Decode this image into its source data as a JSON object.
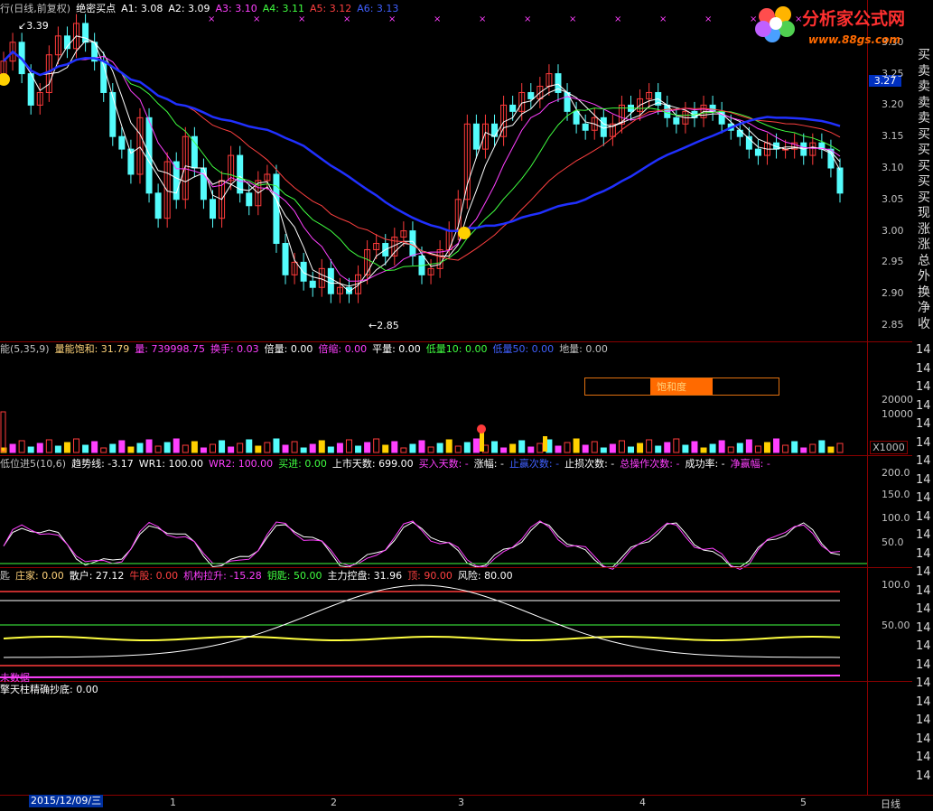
{
  "header": {
    "prefix": "行(日线,前复权)",
    "indicator": "绝密买点",
    "items": [
      {
        "label": "A1: 3.08",
        "color": "#ffffff"
      },
      {
        "label": "A2: 3.09",
        "color": "#ffffff"
      },
      {
        "label": "A3: 3.10",
        "color": "#ff40ff"
      },
      {
        "label": "A4: 3.11",
        "color": "#40ff40"
      },
      {
        "label": "A5: 3.12",
        "color": "#ff4040"
      },
      {
        "label": "A6: 3.13",
        "color": "#4060ff"
      }
    ]
  },
  "price_panel": {
    "high_mark": "3.39",
    "low_mark": "2.85",
    "current_price": "3.27",
    "axis": [
      "3.30",
      "3.25",
      "3.20",
      "3.15",
      "3.10",
      "3.05",
      "3.00",
      "2.95",
      "2.90",
      "2.85"
    ]
  },
  "volume_panel": {
    "header": [
      {
        "label": "能(5,35,9)",
        "color": "#c0c0c0"
      },
      {
        "label": "量能饱和: 31.79",
        "color": "#ffd37a"
      },
      {
        "label": "量: 739998.75",
        "color": "#ff40ff"
      },
      {
        "label": "换手: 0.03",
        "color": "#ff40ff"
      },
      {
        "label": "倍量: 0.00",
        "color": "#ffffff"
      },
      {
        "label": "倍缩: 0.00",
        "color": "#ff40ff"
      },
      {
        "label": "平量: 0.00",
        "color": "#ffffff"
      },
      {
        "label": "低量10: 0.00",
        "color": "#40ff40"
      },
      {
        "label": "低量50: 0.00",
        "color": "#4060ff"
      },
      {
        "label": "地量: 0.00",
        "color": "#c0c0c0"
      }
    ],
    "saturation_label": "饱和度",
    "axis": [
      "20000",
      "10000"
    ],
    "unit": "X1000"
  },
  "wr_panel": {
    "header": [
      {
        "label": "低位进5(10,6)",
        "color": "#c0c0c0"
      },
      {
        "label": "趋势线: -3.17",
        "color": "#ffffff"
      },
      {
        "label": "WR1: 100.00",
        "color": "#ffffff"
      },
      {
        "label": "WR2: 100.00",
        "color": "#ff40ff"
      },
      {
        "label": "买进: 0.00",
        "color": "#40ff40"
      },
      {
        "label": "上市天数: 699.00",
        "color": "#ffffff"
      },
      {
        "label": "买入天数: -",
        "color": "#ff40ff"
      },
      {
        "label": "涨幅: -",
        "color": "#ffffff"
      },
      {
        "label": "止赢次数: -",
        "color": "#4060ff"
      },
      {
        "label": "止损次数: -",
        "color": "#ffffff"
      },
      {
        "label": "总操作次数: -",
        "color": "#ff40ff"
      },
      {
        "label": "成功率: -",
        "color": "#ffffff"
      },
      {
        "label": "净赢幅: -",
        "color": "#ff40ff"
      }
    ],
    "axis": [
      "200.0",
      "150.0",
      "100.0",
      "50.0"
    ]
  },
  "chip_panel": {
    "header": [
      {
        "label": "匙",
        "color": "#c0c0c0"
      },
      {
        "label": "庄家: 0.00",
        "color": "#ffd37a"
      },
      {
        "label": "散户: 27.12",
        "color": "#ffffff"
      },
      {
        "label": "牛股: 0.00",
        "color": "#ff4040"
      },
      {
        "label": "机构拉升: -15.28",
        "color": "#ff40ff"
      },
      {
        "label": "钥匙: 50.00",
        "color": "#40ff40"
      },
      {
        "label": "主力控盘: 31.96",
        "color": "#ffffff"
      },
      {
        "label": "顶: 90.00",
        "color": "#ff4040"
      },
      {
        "label": "风险: 80.00",
        "color": "#ffffff"
      }
    ],
    "no_data": "未数据",
    "axis": [
      "100.0",
      "50.00"
    ]
  },
  "bottom_panel": {
    "header": "擎天柱精确抄底: 0.00"
  },
  "time_axis": {
    "date": "2015/12/09/三",
    "months": [
      "1",
      "2",
      "3",
      "4",
      "5"
    ],
    "period": "日线"
  },
  "right_labels": [
    "买",
    "卖",
    "卖",
    "卖",
    "卖",
    "买",
    "买",
    "买",
    "买",
    "买",
    "现",
    "涨",
    "涨",
    "总",
    "外",
    "换",
    "净",
    "收"
  ],
  "right_index": [
    "14",
    "14",
    "14",
    "14",
    "14",
    "14",
    "14",
    "14",
    "14",
    "14",
    "14",
    "14",
    "14",
    "14",
    "14",
    "14",
    "14",
    "14",
    "14",
    "14",
    "14",
    "14",
    "14",
    "14"
  ],
  "logo": {
    "text": "分析家公式网",
    "url": "www.88gs.com"
  },
  "chart_data": {
    "type": "candlestick",
    "title": "",
    "ylim": [
      2.85,
      3.39
    ],
    "close": [
      3.27,
      3.3,
      3.25,
      3.2,
      3.22,
      3.28,
      3.31,
      3.29,
      3.33,
      3.3,
      3.27,
      3.22,
      3.15,
      3.13,
      3.09,
      3.18,
      3.06,
      3.02,
      3.11,
      3.05,
      3.15,
      3.1,
      3.05,
      3.02,
      3.08,
      3.12,
      3.06,
      3.04,
      3.08,
      3.09,
      2.98,
      2.93,
      2.95,
      2.92,
      2.91,
      2.94,
      2.9,
      2.91,
      2.9,
      2.93,
      2.97,
      2.98,
      2.96,
      2.99,
      3.0,
      2.96,
      2.93,
      2.94,
      2.97,
      3.0,
      3.05,
      3.17,
      3.13,
      3.17,
      3.15,
      3.2,
      3.19,
      3.22,
      3.21,
      3.23,
      3.25,
      3.22,
      3.19,
      3.17,
      3.16,
      3.18,
      3.15,
      3.17,
      3.2,
      3.19,
      3.21,
      3.22,
      3.2,
      3.18,
      3.17,
      3.19,
      3.18,
      3.2,
      3.19,
      3.17,
      3.16,
      3.15,
      3.13,
      3.12,
      3.14,
      3.13,
      3.13,
      3.14,
      3.12,
      3.14,
      3.13,
      3.1,
      3.06
    ]
  }
}
